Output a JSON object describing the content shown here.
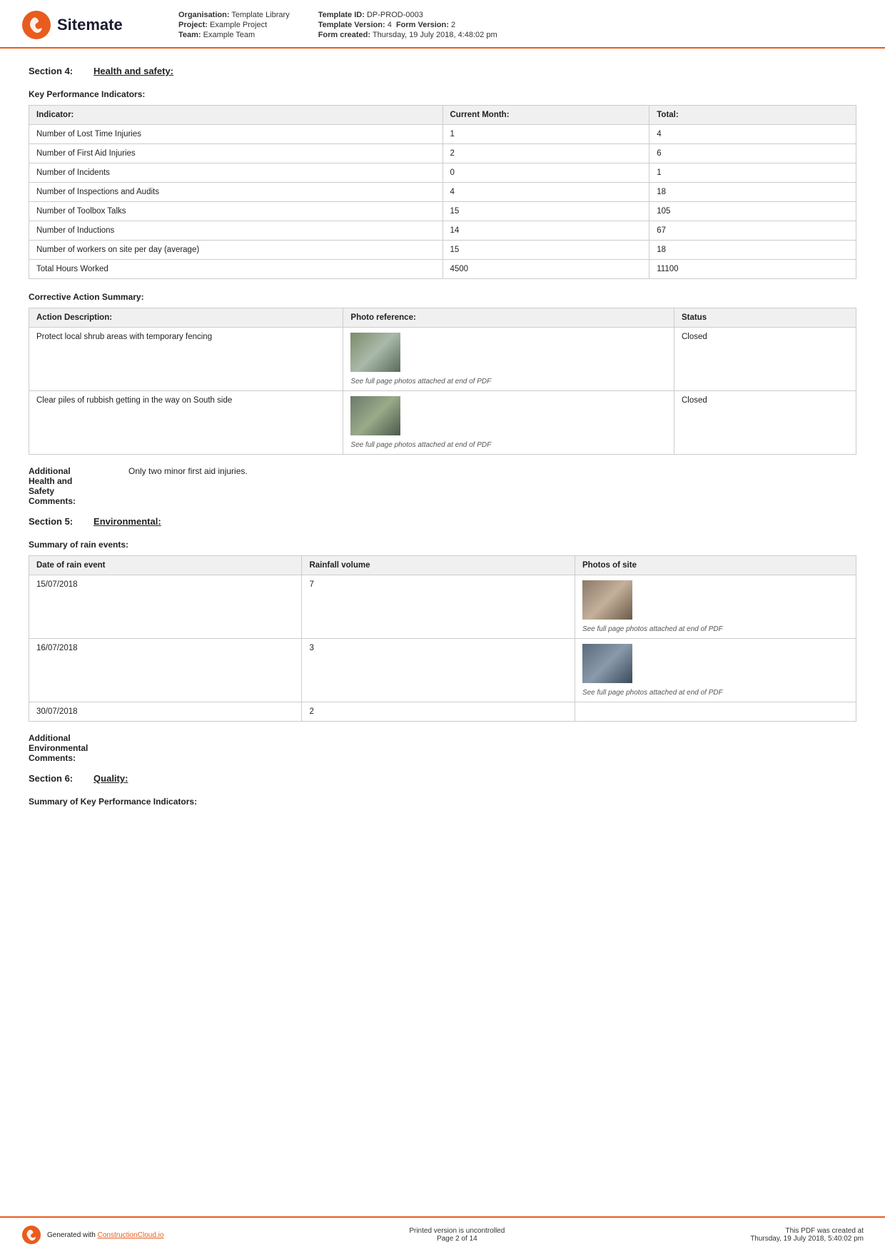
{
  "header": {
    "logo_text": "Sitemate",
    "org_label": "Organisation:",
    "org_value": "Template Library",
    "project_label": "Project:",
    "project_value": "Example Project",
    "team_label": "Team:",
    "team_value": "Example Team",
    "template_id_label": "Template ID:",
    "template_id_value": "DP-PROD-0003",
    "template_version_label": "Template Version:",
    "template_version_value": "4",
    "form_version_label": "Form Version:",
    "form_version_value": "2",
    "form_created_label": "Form created:",
    "form_created_value": "Thursday, 19 July 2018, 4:48:02 pm"
  },
  "section4": {
    "label": "Section 4:",
    "title": "Health and safety:"
  },
  "kpi": {
    "heading": "Key Performance Indicators:",
    "columns": [
      "Indicator:",
      "Current Month:",
      "Total:"
    ],
    "rows": [
      {
        "indicator": "Number of Lost Time Injuries",
        "month": "1",
        "total": "4"
      },
      {
        "indicator": "Number of First Aid Injuries",
        "month": "2",
        "total": "6"
      },
      {
        "indicator": "Number of Incidents",
        "month": "0",
        "total": "1"
      },
      {
        "indicator": "Number of Inspections and Audits",
        "month": "4",
        "total": "18"
      },
      {
        "indicator": "Number of Toolbox Talks",
        "month": "15",
        "total": "105"
      },
      {
        "indicator": "Number of Inductions",
        "month": "14",
        "total": "67"
      },
      {
        "indicator": "Number of workers on site per day (average)",
        "month": "15",
        "total": "18"
      },
      {
        "indicator": "Total Hours Worked",
        "month": "4500",
        "total": "11100"
      }
    ]
  },
  "corrective_action": {
    "heading": "Corrective Action Summary:",
    "columns": [
      "Action Description:",
      "Photo reference:",
      "Status"
    ],
    "rows": [
      {
        "description": "Protect local shrub areas with temporary fencing",
        "photo_caption": "See full page photos attached at end of PDF",
        "status": "Closed",
        "photo_class": "action1"
      },
      {
        "description": "Clear piles of rubbish getting in the way on South side",
        "photo_caption": "See full page photos attached at end of PDF",
        "status": "Closed",
        "photo_class": "action2"
      }
    ]
  },
  "health_comments": {
    "label": "Additional Health and Safety Comments:",
    "text": "Only two minor first aid injuries."
  },
  "section5": {
    "label": "Section 5:",
    "title": "Environmental:"
  },
  "rain_events": {
    "heading": "Summary of rain events:",
    "columns": [
      "Date of rain event",
      "Rainfall volume",
      "Photos of site"
    ],
    "rows": [
      {
        "date": "15/07/2018",
        "volume": "7",
        "photo_caption": "See full page photos attached at end of PDF",
        "photo_class": "rain1"
      },
      {
        "date": "16/07/2018",
        "volume": "3",
        "photo_caption": "See full page photos attached at end of PDF",
        "photo_class": "rain2"
      },
      {
        "date": "30/07/2018",
        "volume": "2",
        "photo_caption": "",
        "photo_class": ""
      }
    ]
  },
  "env_comments": {
    "label": "Additional Environmental Comments:"
  },
  "section6": {
    "label": "Section 6:",
    "title": "Quality:"
  },
  "quality_kpi": {
    "heading": "Summary of Key Performance Indicators:"
  },
  "footer": {
    "generated_text": "Generated with",
    "link_text": "ConstructionCloud.io",
    "center_line1": "Printed version is uncontrolled",
    "center_line2": "Page 2 of 14",
    "right_line1": "This PDF was created at",
    "right_line2": "Thursday, 19 July 2018, 5:40:02 pm"
  }
}
